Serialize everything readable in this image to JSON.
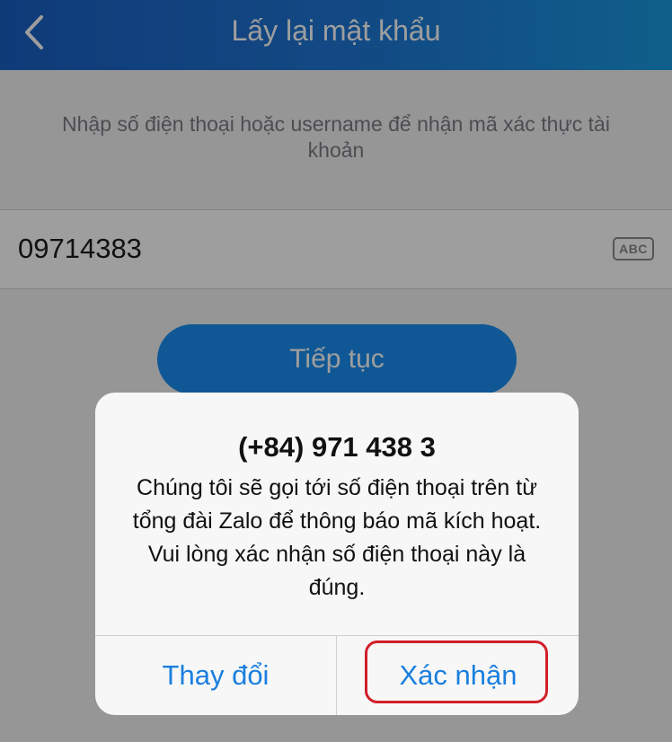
{
  "header": {
    "title": "Lấy lại mật khẩu",
    "back_icon": "chevron-left-icon"
  },
  "instruction": {
    "text": "Nhập số điện thoại hoặc username để nhận mã xác thực tài khoản"
  },
  "phone_input": {
    "value": "09714383",
    "keyboard_badge": "ABC"
  },
  "continue_button": {
    "label": "Tiếp tục"
  },
  "dialog": {
    "title": "(+84) 971 438 3",
    "message": "Chúng tôi sẽ gọi tới số điện thoại trên từ tổng đài Zalo để thông báo mã kích hoạt. Vui lòng xác nhận số điện thoại này là đúng.",
    "change_label": "Thay đổi",
    "confirm_label": "Xác nhận"
  },
  "colors": {
    "header_start": "#1a5fc4",
    "header_end": "#1a9ae0",
    "accent": "#1a7fde",
    "highlight": "#d11f2a"
  }
}
